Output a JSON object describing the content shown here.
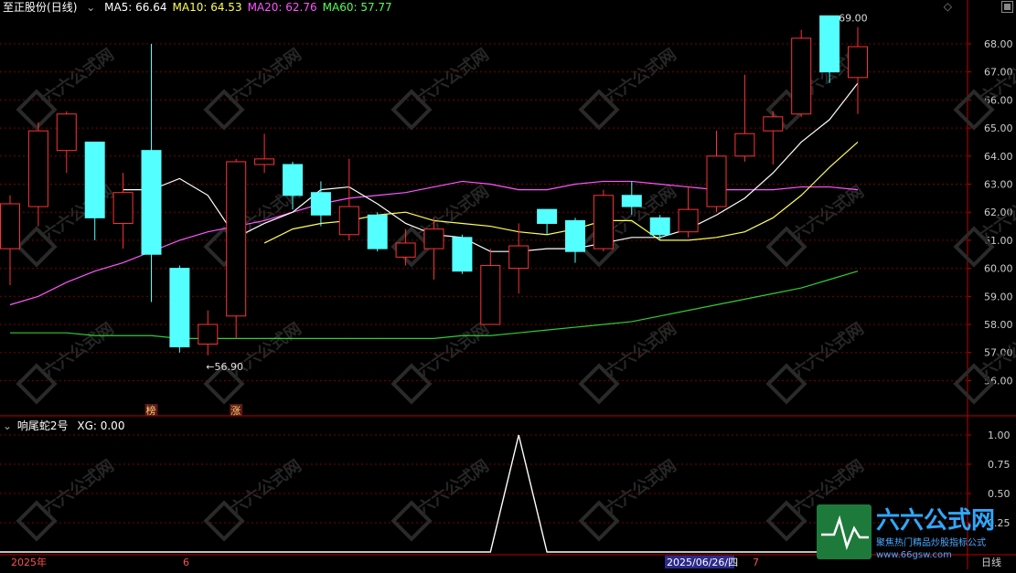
{
  "header": {
    "stock_name": "至正股份",
    "period": "(日线)",
    "ma": [
      {
        "label": "MA5: 66.64",
        "color": "#ffffff"
      },
      {
        "label": "MA10: 64.53",
        "color": "#ffff55"
      },
      {
        "label": "MA20: 62.76",
        "color": "#ff55ff"
      },
      {
        "label": "MA60: 57.77",
        "color": "#55ff55"
      }
    ]
  },
  "sub_header": {
    "name": "响尾蛇2号",
    "value": "XG: 0.00"
  },
  "corner_icon": "diamond-icon",
  "footer": {
    "left": "2025年",
    "mid": "6",
    "date_cursor": "2025/06/26/四",
    "right": "7",
    "period_label": "日线"
  },
  "markers": [
    {
      "label": "榜",
      "index": 5
    },
    {
      "label": "涨",
      "index": 8
    }
  ],
  "watermark": {
    "name": "六六公式网",
    "slogan": "聚焦热门精品炒股指标公式",
    "url": "www.66gsw.com"
  },
  "colors": {
    "up": "#ff3232",
    "down": "#54ffff",
    "grid": "#7a0000",
    "axis": "#c00000",
    "ma5": "#ffffff",
    "ma10": "#ffff55",
    "ma20": "#ff55ff",
    "ma60": "#33cc33"
  },
  "chart_data": [
    {
      "type": "candlestick",
      "y_ticks": [
        "56.00",
        "57.00",
        "58.00",
        "59.00",
        "60.00",
        "61.00",
        "62.00",
        "63.00",
        "64.00",
        "65.00",
        "66.00",
        "67.00",
        "68.00"
      ],
      "ylim": [
        55.55,
        69.0
      ],
      "annotations": [
        {
          "text": "←56.90",
          "index": 7,
          "value": 56.9
        },
        {
          "text": "69.00",
          "index": 29,
          "value": 69.0
        }
      ],
      "candles": [
        {
          "o": 60.7,
          "c": 62.3,
          "h": 62.6,
          "l": 59.4
        },
        {
          "o": 62.2,
          "c": 64.9,
          "h": 65.2,
          "l": 61.5
        },
        {
          "o": 64.2,
          "c": 65.5,
          "h": 65.6,
          "l": 63.4
        },
        {
          "o": 64.5,
          "c": 61.8,
          "h": 64.5,
          "l": 61.0
        },
        {
          "o": 61.6,
          "c": 62.7,
          "h": 63.4,
          "l": 60.7
        },
        {
          "o": 64.2,
          "c": 60.5,
          "h": 68.0,
          "l": 58.8
        },
        {
          "o": 60.0,
          "c": 57.2,
          "h": 60.1,
          "l": 57.0
        },
        {
          "o": 57.3,
          "c": 58.0,
          "h": 58.5,
          "l": 56.9
        },
        {
          "o": 58.3,
          "c": 63.8,
          "h": 63.9,
          "l": 57.5
        },
        {
          "o": 63.7,
          "c": 63.9,
          "h": 64.8,
          "l": 63.4
        },
        {
          "o": 63.7,
          "c": 62.6,
          "h": 63.8,
          "l": 62.1
        },
        {
          "o": 62.7,
          "c": 61.9,
          "h": 63.1,
          "l": 61.5
        },
        {
          "o": 61.2,
          "c": 62.2,
          "h": 63.9,
          "l": 61.0
        },
        {
          "o": 61.9,
          "c": 60.7,
          "h": 62.0,
          "l": 60.6
        },
        {
          "o": 60.4,
          "c": 60.9,
          "h": 61.4,
          "l": 60.1
        },
        {
          "o": 60.7,
          "c": 61.4,
          "h": 61.8,
          "l": 59.6
        },
        {
          "o": 61.1,
          "c": 59.9,
          "h": 61.2,
          "l": 59.8
        },
        {
          "o": 58.0,
          "c": 60.1,
          "h": 60.7,
          "l": 58.0
        },
        {
          "o": 60.0,
          "c": 60.8,
          "h": 61.6,
          "l": 59.1
        },
        {
          "o": 62.1,
          "c": 61.6,
          "h": 62.1,
          "l": 61.2
        },
        {
          "o": 61.7,
          "c": 60.6,
          "h": 61.8,
          "l": 60.2
        },
        {
          "o": 60.7,
          "c": 62.6,
          "h": 62.8,
          "l": 60.6
        },
        {
          "o": 62.6,
          "c": 62.2,
          "h": 63.1,
          "l": 61.9
        },
        {
          "o": 61.8,
          "c": 61.2,
          "h": 61.9,
          "l": 61.0
        },
        {
          "o": 61.3,
          "c": 62.1,
          "h": 62.9,
          "l": 61.1
        },
        {
          "o": 62.2,
          "c": 64.0,
          "h": 64.9,
          "l": 62.0
        },
        {
          "o": 64.0,
          "c": 64.8,
          "h": 66.9,
          "l": 63.8
        },
        {
          "o": 64.9,
          "c": 65.4,
          "h": 65.6,
          "l": 63.7
        },
        {
          "o": 65.5,
          "c": 68.2,
          "h": 68.5,
          "l": 65.4
        },
        {
          "o": 69.0,
          "c": 67.0,
          "h": 69.0,
          "l": 66.6
        },
        {
          "o": 66.8,
          "c": 67.9,
          "h": 68.6,
          "l": 65.5
        }
      ],
      "ma5": [
        null,
        null,
        null,
        null,
        62.8,
        62.8,
        63.2,
        62.6,
        61.1,
        61.6,
        62.0,
        62.8,
        62.9,
        62.3,
        61.6,
        61.2,
        61.1,
        60.6,
        60.6,
        60.7,
        60.7,
        60.9,
        61.1,
        61.1,
        61.4,
        61.9,
        62.5,
        63.4,
        64.5,
        65.3,
        66.6
      ],
      "ma10": [
        null,
        null,
        null,
        null,
        null,
        null,
        null,
        null,
        null,
        60.9,
        61.4,
        61.6,
        61.7,
        61.9,
        62.0,
        61.7,
        61.6,
        61.5,
        61.3,
        61.2,
        61.4,
        61.7,
        61.7,
        61.0,
        61.0,
        61.1,
        61.3,
        61.8,
        62.6,
        63.6,
        64.5
      ],
      "ma20": [
        58.7,
        59.0,
        59.5,
        59.9,
        60.2,
        60.6,
        61.0,
        61.3,
        61.5,
        61.7,
        62.0,
        62.3,
        62.5,
        62.6,
        62.7,
        62.9,
        63.1,
        63.0,
        62.8,
        62.8,
        63.0,
        63.1,
        63.1,
        63.0,
        62.9,
        62.8,
        62.8,
        62.8,
        62.9,
        62.9,
        62.8
      ],
      "ma60": [
        57.7,
        57.7,
        57.7,
        57.6,
        57.6,
        57.6,
        57.5,
        57.5,
        57.5,
        57.5,
        57.5,
        57.5,
        57.5,
        57.5,
        57.5,
        57.5,
        57.6,
        57.6,
        57.7,
        57.8,
        57.9,
        58.0,
        58.1,
        58.3,
        58.5,
        58.7,
        58.9,
        59.1,
        59.3,
        59.6,
        59.9
      ]
    },
    {
      "type": "line",
      "name": "XG",
      "y_ticks": [
        "0.25",
        "0.50",
        "0.75",
        "1.00"
      ],
      "ylim": [
        0,
        1
      ],
      "values": [
        0,
        0,
        0,
        0,
        0,
        0,
        0,
        0,
        0,
        0,
        0,
        0,
        0,
        0,
        0,
        0,
        0,
        0,
        1,
        0,
        0,
        0,
        0,
        0,
        0,
        0,
        0,
        0,
        0,
        0,
        0
      ]
    }
  ]
}
